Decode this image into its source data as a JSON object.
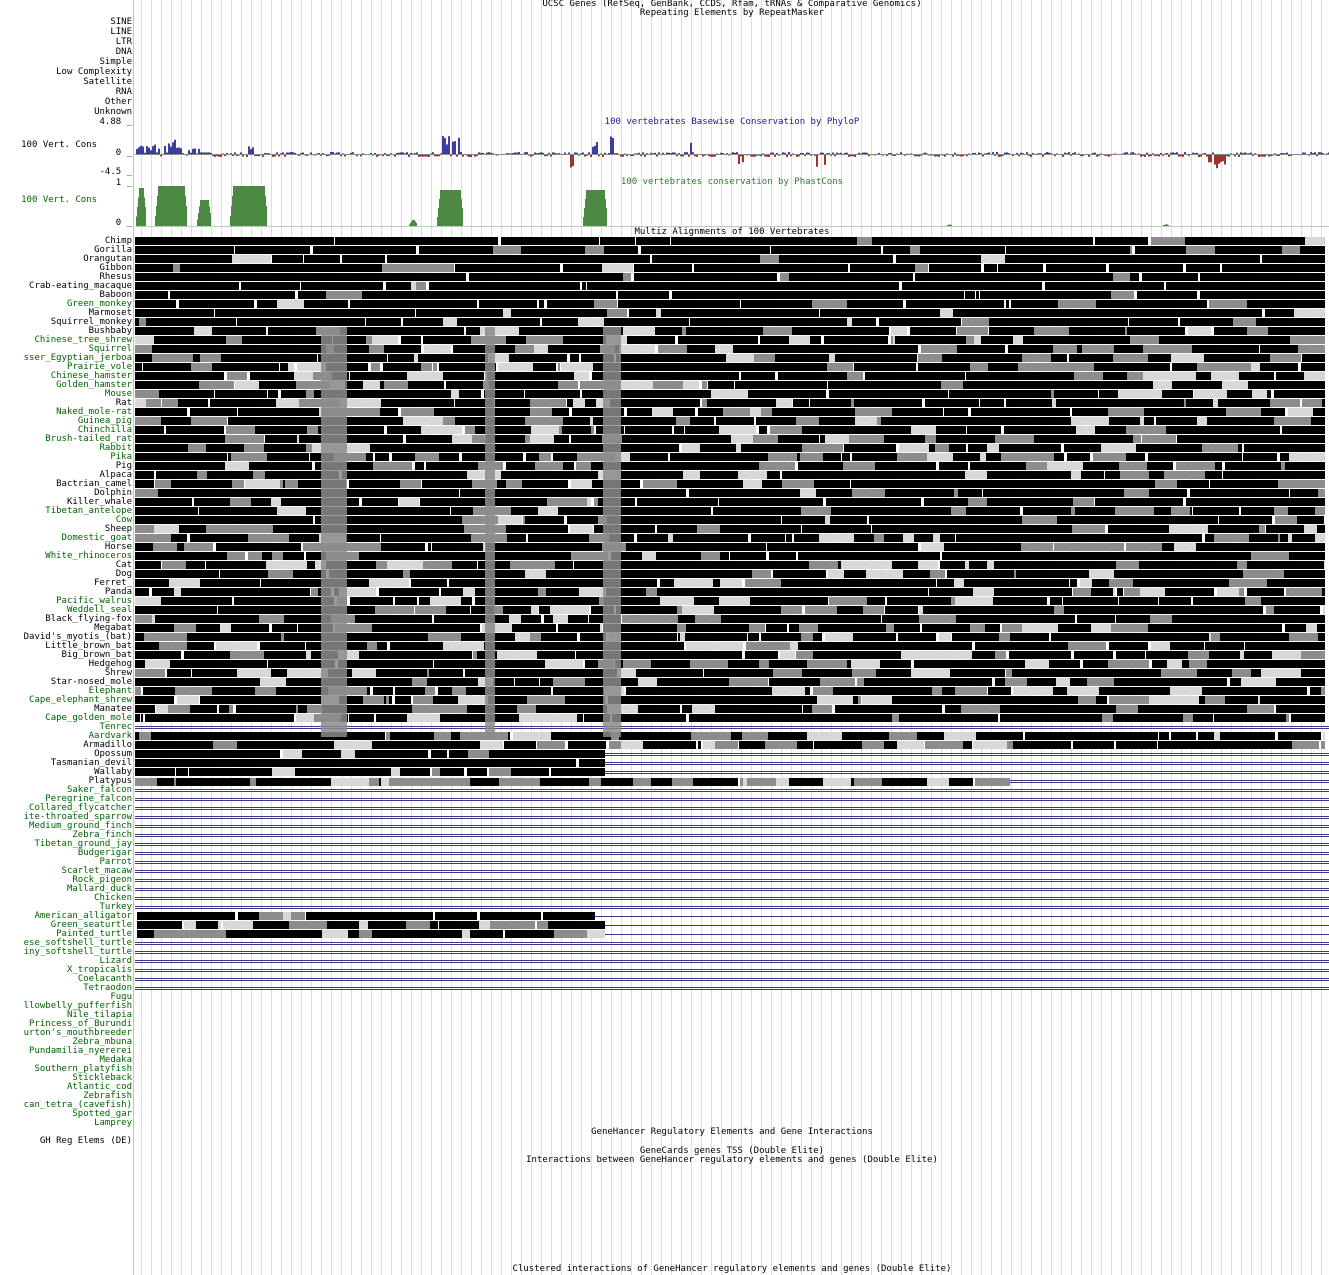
{
  "colors": {
    "label_default": "#000000",
    "label_green": "#006400",
    "phylop_title": "#19198c",
    "phylop_pos": "#3d3d9f",
    "phylop_neg": "#9d3232",
    "phastcons": "#4c8a44",
    "phastcons_title": "#2f7a2f",
    "grid": "#dddde8",
    "divider": "#f0b0b0",
    "chain_line": "#3a3a8a",
    "align_dark": "#000000",
    "align_mid": "#8c8c8c",
    "align_light": "#d8d8d8"
  },
  "tracks": {
    "ucsc_genes_title": "UCSC Genes (RefSeq, GenBank, CCDS, Rfam, tRNAs & Comparative Genomics)",
    "repeatmasker_title": "Repeating Elements by RepeatMasker",
    "repeat_classes": [
      "SINE",
      "LINE",
      "LTR",
      "DNA",
      "Simple",
      "Low Complexity",
      "Satellite",
      "RNA",
      "Other",
      "Unknown"
    ],
    "phylop": {
      "title": "100 vertebrates Basewise Conservation by PhyloP",
      "label": "100 Vert. Cons",
      "max": "4.88 _",
      "zero": "0 _",
      "min": "-4.5 _"
    },
    "phastcons": {
      "title": "100 vertebrates conservation by PhastCons",
      "label": "100 Vert. Cons",
      "max": "1 _",
      "zero": "0 _"
    },
    "multiz_title": "Multiz Alignments of 100 Vertebrates",
    "genehancer_title": "GeneHancer Regulatory Elements and Gene Interactions",
    "genehancer_label": "GH Reg Elems (DE)",
    "genecards_tss_title": "GeneCards genes TSS (Double Elite)",
    "interactions_title": "Interactions between GeneHancer regulatory elements and genes (Double Elite)",
    "clustered_title": "Clustered interactions of GeneHancer regulatory elements and genes (Double Elite)"
  },
  "species": [
    {
      "name": "Chimp",
      "g": 0,
      "t": "full"
    },
    {
      "name": "Gorilla",
      "g": 0,
      "t": "full"
    },
    {
      "name": "Orangutan",
      "g": 0,
      "t": "full"
    },
    {
      "name": "Gibbon",
      "g": 0,
      "t": "full"
    },
    {
      "name": "Rhesus",
      "g": 0,
      "t": "full"
    },
    {
      "name": "Crab-eating_macaque",
      "g": 0,
      "t": "full"
    },
    {
      "name": "Baboon",
      "g": 0,
      "t": "full"
    },
    {
      "name": "Green_monkey",
      "g": 1,
      "t": "full"
    },
    {
      "name": "Marmoset",
      "g": 0,
      "t": "full"
    },
    {
      "name": "Squirrel_monkey",
      "g": 0,
      "t": "full"
    },
    {
      "name": "Bushbaby",
      "g": 0,
      "t": "full"
    },
    {
      "name": "Chinese_tree_shrew",
      "g": 1,
      "t": "full"
    },
    {
      "name": "Squirrel",
      "g": 1,
      "t": "full"
    },
    {
      "name": "sser_Egyptian_jerboa",
      "g": 1,
      "t": "full"
    },
    {
      "name": "Prairie_vole",
      "g": 1,
      "t": "full"
    },
    {
      "name": "Chinese_hamster",
      "g": 1,
      "t": "full"
    },
    {
      "name": "Golden_hamster",
      "g": 1,
      "t": "full"
    },
    {
      "name": "Mouse",
      "g": 1,
      "t": "full"
    },
    {
      "name": "Rat",
      "g": 0,
      "t": "full"
    },
    {
      "name": "Naked_mole-rat",
      "g": 1,
      "t": "full"
    },
    {
      "name": "Guinea_pig",
      "g": 1,
      "t": "full"
    },
    {
      "name": "Chinchilla",
      "g": 1,
      "t": "full"
    },
    {
      "name": "Brush-tailed_rat",
      "g": 1,
      "t": "full"
    },
    {
      "name": "Rabbit",
      "g": 1,
      "t": "full"
    },
    {
      "name": "Pika",
      "g": 1,
      "t": "full"
    },
    {
      "name": "Pig",
      "g": 0,
      "t": "full"
    },
    {
      "name": "Alpaca",
      "g": 0,
      "t": "full"
    },
    {
      "name": "Bactrian_camel",
      "g": 0,
      "t": "full"
    },
    {
      "name": "Dolphin",
      "g": 0,
      "t": "full"
    },
    {
      "name": "Killer_whale",
      "g": 0,
      "t": "full"
    },
    {
      "name": "Tibetan_antelope",
      "g": 1,
      "t": "full"
    },
    {
      "name": "Cow",
      "g": 1,
      "t": "full"
    },
    {
      "name": "Sheep",
      "g": 0,
      "t": "full"
    },
    {
      "name": "Domestic_goat",
      "g": 1,
      "t": "full"
    },
    {
      "name": "Horse",
      "g": 0,
      "t": "full"
    },
    {
      "name": "White_rhinoceros",
      "g": 1,
      "t": "full"
    },
    {
      "name": "Cat",
      "g": 0,
      "t": "full"
    },
    {
      "name": "Dog",
      "g": 0,
      "t": "full"
    },
    {
      "name": "Ferret_",
      "g": 0,
      "t": "full"
    },
    {
      "name": "Panda",
      "g": 0,
      "t": "full"
    },
    {
      "name": "Pacific_walrus",
      "g": 1,
      "t": "full"
    },
    {
      "name": "Weddell_seal",
      "g": 1,
      "t": "full"
    },
    {
      "name": "Black_flying-fox",
      "g": 0,
      "t": "full"
    },
    {
      "name": "Megabat",
      "g": 0,
      "t": "full"
    },
    {
      "name": "David's_myotis_(bat)",
      "g": 0,
      "t": "full"
    },
    {
      "name": "Little_brown_bat",
      "g": 0,
      "t": "full"
    },
    {
      "name": "Big_brown_bat",
      "g": 0,
      "t": "full"
    },
    {
      "name": "Hedgehog",
      "g": 0,
      "t": "hedge"
    },
    {
      "name": "Shrew",
      "g": 0,
      "t": "full"
    },
    {
      "name": "Star-nosed_mole",
      "g": 0,
      "t": "full"
    },
    {
      "name": "Elephant",
      "g": 1,
      "t": "full"
    },
    {
      "name": "Cape_elephant_shrew",
      "g": 1,
      "t": "full"
    },
    {
      "name": "Manatee",
      "g": 0,
      "t": "full"
    },
    {
      "name": "Cape_golden_mole",
      "g": 1,
      "t": "full"
    },
    {
      "name": "Tenrec",
      "g": 1,
      "t": "line"
    },
    {
      "name": "Aardvark",
      "g": 1,
      "t": "full"
    },
    {
      "name": "Armadillo",
      "g": 0,
      "t": "full"
    },
    {
      "name": "Opossum",
      "g": 0,
      "t": "partial"
    },
    {
      "name": "Tasmanian_devil",
      "g": 0,
      "t": "partial"
    },
    {
      "name": "Wallaby",
      "g": 0,
      "t": "partial"
    },
    {
      "name": "Platypus",
      "g": 0,
      "t": "platypus"
    },
    {
      "name": "Saker_falcon",
      "g": 1,
      "t": "line"
    },
    {
      "name": "Peregrine_falcon",
      "g": 1,
      "t": "line"
    },
    {
      "name": "Collared_flycatcher",
      "g": 1,
      "t": "line"
    },
    {
      "name": "ite-throated_sparrow",
      "g": 1,
      "t": "line"
    },
    {
      "name": "Medium_ground_finch",
      "g": 1,
      "t": "line"
    },
    {
      "name": "Zebra_finch",
      "g": 1,
      "t": "line"
    },
    {
      "name": "Tibetan_ground_jay",
      "g": 1,
      "t": "line"
    },
    {
      "name": "Budgerigar",
      "g": 1,
      "t": "line"
    },
    {
      "name": "Parrot",
      "g": 1,
      "t": "line"
    },
    {
      "name": "Scarlet_macaw",
      "g": 1,
      "t": "line"
    },
    {
      "name": "Rock_pigeon",
      "g": 1,
      "t": "line"
    },
    {
      "name": "Mallard_duck",
      "g": 1,
      "t": "line"
    },
    {
      "name": "Chicken",
      "g": 1,
      "t": "line"
    },
    {
      "name": "Turkey",
      "g": 1,
      "t": "line"
    },
    {
      "name": "American_alligator",
      "g": 1,
      "t": "reptile"
    },
    {
      "name": "Green_seaturtle",
      "g": 1,
      "t": "reptile"
    },
    {
      "name": "Painted_turtle",
      "g": 1,
      "t": "reptile"
    },
    {
      "name": "ese_softshell_turtle",
      "g": 1,
      "t": "line"
    },
    {
      "name": "iny_softshell_turtle",
      "g": 1,
      "t": "line"
    },
    {
      "name": "Lizard",
      "g": 1,
      "t": "line"
    },
    {
      "name": "X_tropicalis",
      "g": 1,
      "t": "line"
    },
    {
      "name": "Coelacanth",
      "g": 1,
      "t": "line"
    },
    {
      "name": "Tetraodon",
      "g": 1,
      "t": "line"
    },
    {
      "name": "Fugu",
      "g": 1,
      "t": "none"
    },
    {
      "name": "llowbelly_pufferfish",
      "g": 1,
      "t": "none"
    },
    {
      "name": "Nile_tilapia",
      "g": 1,
      "t": "none"
    },
    {
      "name": "Princess_of_Burundi",
      "g": 1,
      "t": "none"
    },
    {
      "name": "urton's_mouthbreeder",
      "g": 1,
      "t": "none"
    },
    {
      "name": "Zebra_mbuna",
      "g": 1,
      "t": "none"
    },
    {
      "name": "Pundamilia_nyererei",
      "g": 1,
      "t": "none"
    },
    {
      "name": "Medaka",
      "g": 1,
      "t": "none"
    },
    {
      "name": "Southern_platyfish",
      "g": 1,
      "t": "none"
    },
    {
      "name": "Stickleback",
      "g": 1,
      "t": "none"
    },
    {
      "name": "Atlantic_cod",
      "g": 1,
      "t": "none"
    },
    {
      "name": "Zebrafish",
      "g": 1,
      "t": "none"
    },
    {
      "name": "can_tetra_(cavefish)",
      "g": 1,
      "t": "none"
    },
    {
      "name": "Spotted_gar",
      "g": 1,
      "t": "none"
    },
    {
      "name": "Lamprey",
      "g": 1,
      "t": "none"
    }
  ]
}
